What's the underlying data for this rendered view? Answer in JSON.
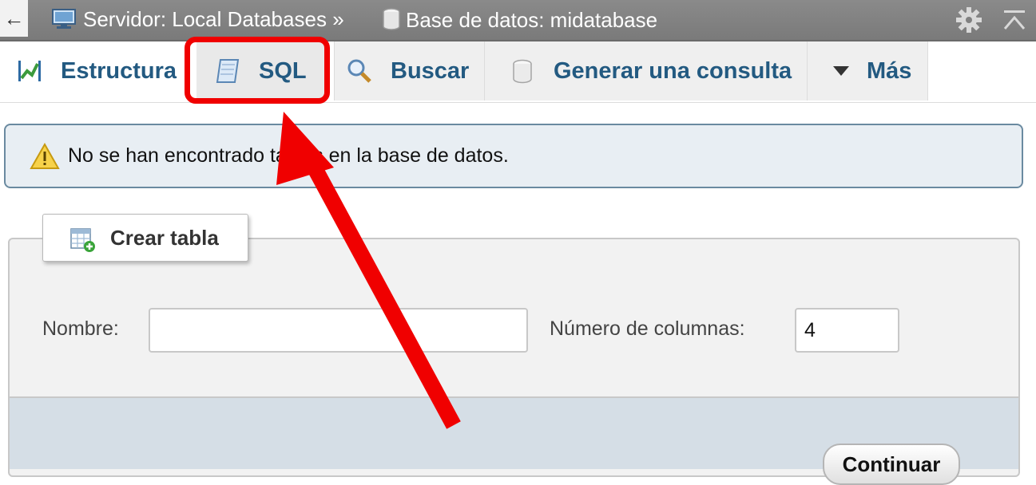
{
  "breadcrumb": {
    "back_glyph": "←",
    "server": "Servidor: Local Databases",
    "separator": "»",
    "database": "Base de datos: midatabase",
    "server_icon": "server-icon",
    "database_icon": "database-icon",
    "settings_icon": "gear-icon",
    "collapse_icon": "collapse-top-icon"
  },
  "tabs": [
    {
      "label": "Estructura",
      "icon": "structure-icon"
    },
    {
      "label": "SQL",
      "icon": "sql-icon"
    },
    {
      "label": "Buscar",
      "icon": "search-icon"
    },
    {
      "label": "Generar una consulta",
      "icon": "query-db-icon"
    },
    {
      "label": "Más",
      "icon": "triangle-down-icon"
    }
  ],
  "notice": {
    "icon": "warning-icon",
    "text": "No se han encontrado tablas en la base de datos."
  },
  "create_table": {
    "legend": "Crear tabla",
    "legend_icon": "add-table-icon",
    "name_label": "Nombre:",
    "name_value": "",
    "columns_label": "Número de columnas:",
    "columns_value": "4",
    "submit_label": "Continuar"
  },
  "colors": {
    "tab_text": "#235a81",
    "highlight": "#f00000",
    "topbar": "#808080",
    "notice_bg": "#e8eef3"
  }
}
